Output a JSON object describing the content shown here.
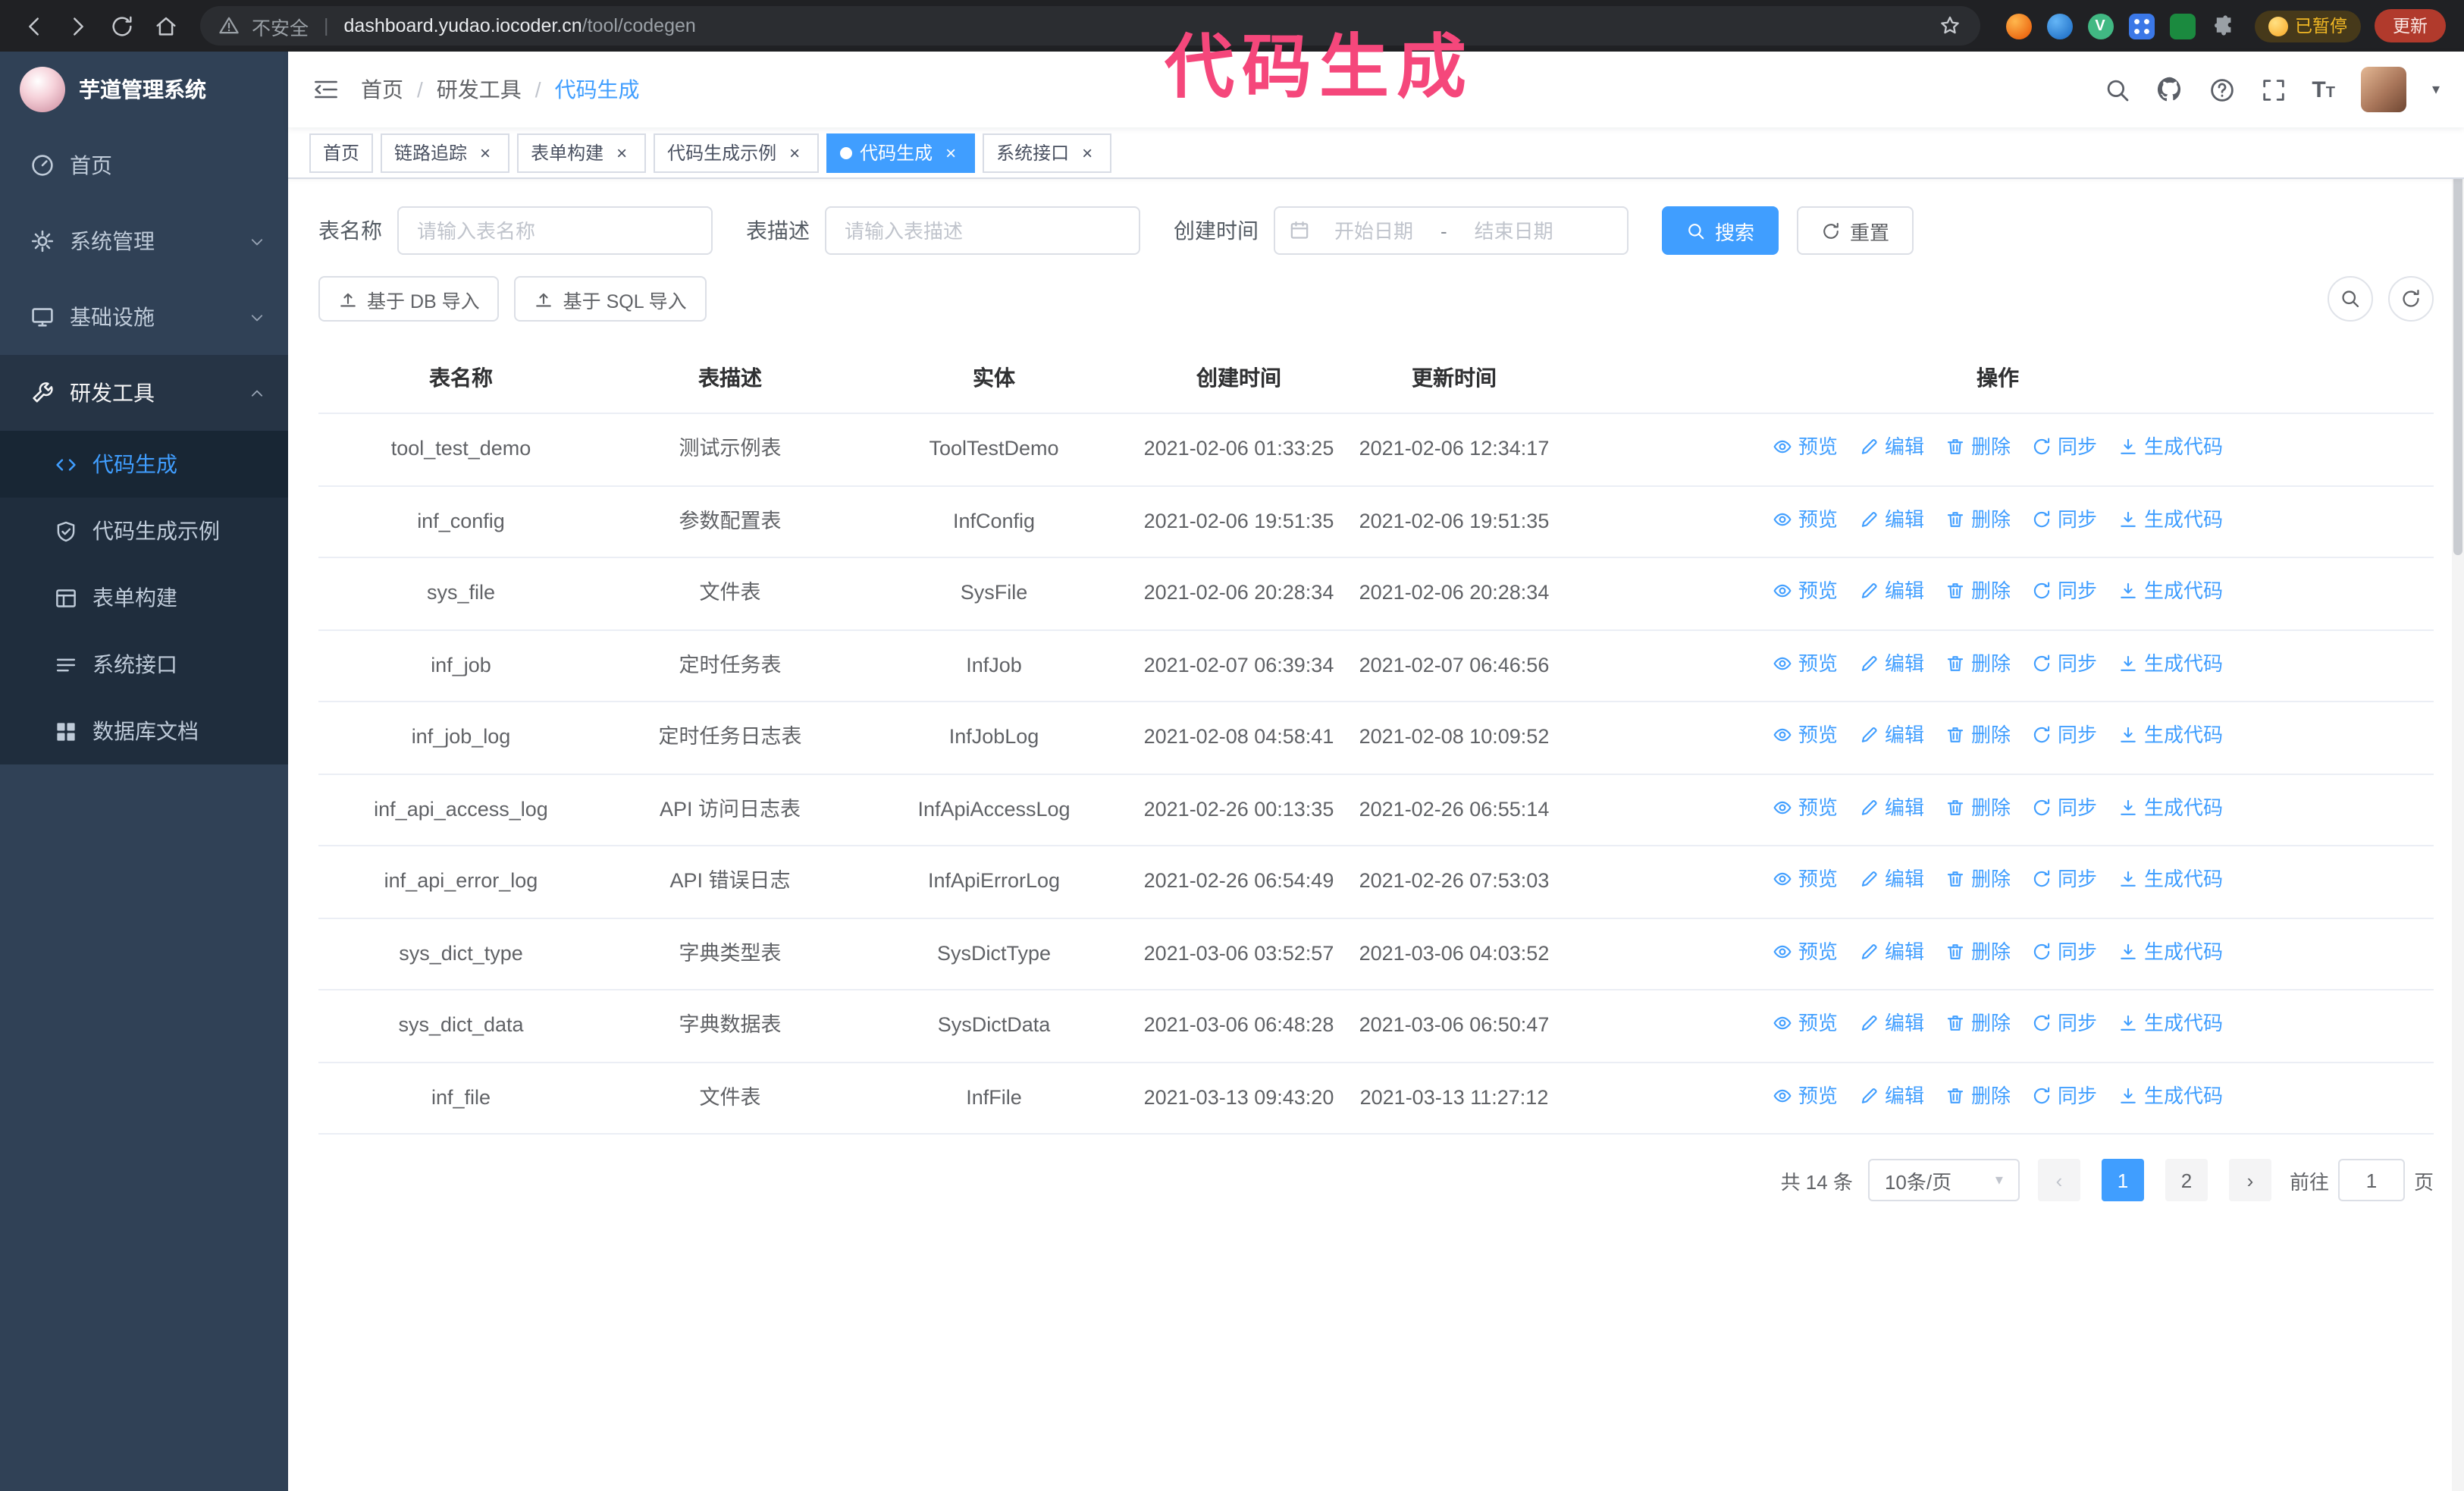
{
  "annotation": {
    "text": "代码生成"
  },
  "colors": {
    "accent": "#409eff",
    "active_tab_bg": "#409eff",
    "sidebar_bg": "#304156",
    "submenu_bg": "#1f2d3d",
    "annotation": "#f5477b"
  },
  "browser": {
    "security_label": "不安全",
    "url_host": "dashboard.yudao.iocoder.cn",
    "url_path": "/tool/codegen",
    "paused_badge": "已暂停",
    "update_button": "更新"
  },
  "sidebar": {
    "logo_title": "芋道管理系统",
    "items": [
      {
        "label": "首页"
      },
      {
        "label": "系统管理"
      },
      {
        "label": "基础设施"
      },
      {
        "label": "研发工具",
        "expanded": true,
        "children": [
          {
            "label": "代码生成",
            "active": true
          },
          {
            "label": "代码生成示例"
          },
          {
            "label": "表单构建"
          },
          {
            "label": "系统接口"
          },
          {
            "label": "数据库文档"
          }
        ]
      }
    ]
  },
  "header": {
    "breadcrumb": [
      "首页",
      "研发工具",
      "代码生成"
    ]
  },
  "tabs": [
    {
      "label": "首页",
      "closable": false
    },
    {
      "label": "链路追踪",
      "closable": true
    },
    {
      "label": "表单构建",
      "closable": true
    },
    {
      "label": "代码生成示例",
      "closable": true
    },
    {
      "label": "代码生成",
      "closable": true,
      "active": true
    },
    {
      "label": "系统接口",
      "closable": true
    }
  ],
  "filters": {
    "table_name_label": "表名称",
    "table_name_placeholder": "请输入表名称",
    "table_desc_label": "表描述",
    "table_desc_placeholder": "请输入表描述",
    "create_time_label": "创建时间",
    "date_start_placeholder": "开始日期",
    "date_separator": "-",
    "date_end_placeholder": "结束日期",
    "search_button": "搜索",
    "reset_button": "重置"
  },
  "toolbar": {
    "import_db_button": "基于 DB 导入",
    "import_sql_button": "基于 SQL 导入"
  },
  "table": {
    "columns": [
      "表名称",
      "表描述",
      "实体",
      "创建时间",
      "更新时间",
      "操作"
    ],
    "actions": [
      "预览",
      "编辑",
      "删除",
      "同步",
      "生成代码"
    ],
    "rows": [
      {
        "name": "tool_test_demo",
        "desc": "测试示例表",
        "entity": "ToolTestDemo",
        "created": "2021-02-06 01:33:25",
        "updated": "2021-02-06 12:34:17"
      },
      {
        "name": "inf_config",
        "desc": "参数配置表",
        "entity": "InfConfig",
        "created": "2021-02-06 19:51:35",
        "updated": "2021-02-06 19:51:35"
      },
      {
        "name": "sys_file",
        "desc": "文件表",
        "entity": "SysFile",
        "created": "2021-02-06 20:28:34",
        "updated": "2021-02-06 20:28:34"
      },
      {
        "name": "inf_job",
        "desc": "定时任务表",
        "entity": "InfJob",
        "created": "2021-02-07 06:39:34",
        "updated": "2021-02-07 06:46:56"
      },
      {
        "name": "inf_job_log",
        "desc": "定时任务日志表",
        "entity": "InfJobLog",
        "created": "2021-02-08 04:58:41",
        "updated": "2021-02-08 10:09:52"
      },
      {
        "name": "inf_api_access_log",
        "desc": "API 访问日志表",
        "entity": "InfApiAccessLog",
        "created": "2021-02-26 00:13:35",
        "updated": "2021-02-26 06:55:14"
      },
      {
        "name": "inf_api_error_log",
        "desc": "API 错误日志",
        "entity": "InfApiErrorLog",
        "created": "2021-02-26 06:54:49",
        "updated": "2021-02-26 07:53:03"
      },
      {
        "name": "sys_dict_type",
        "desc": "字典类型表",
        "entity": "SysDictType",
        "created": "2021-03-06 03:52:57",
        "updated": "2021-03-06 04:03:52"
      },
      {
        "name": "sys_dict_data",
        "desc": "字典数据表",
        "entity": "SysDictData",
        "created": "2021-03-06 06:48:28",
        "updated": "2021-03-06 06:50:47"
      },
      {
        "name": "inf_file",
        "desc": "文件表",
        "entity": "InfFile",
        "created": "2021-03-13 09:43:20",
        "updated": "2021-03-13 11:27:12"
      }
    ]
  },
  "pagination": {
    "total_text": "共 14 条",
    "page_size": "10条/页",
    "pages": [
      "1",
      "2"
    ],
    "active_page": "1",
    "goto_label": "前往",
    "goto_value": "1",
    "goto_suffix": "页"
  },
  "icons": {
    "nav": [
      "search-icon",
      "github-icon",
      "help-icon",
      "fullscreen-icon",
      "font-size-icon"
    ],
    "row_actions": [
      "eye-icon",
      "pencil-icon",
      "trash-icon",
      "sync-icon",
      "download-icon"
    ]
  }
}
